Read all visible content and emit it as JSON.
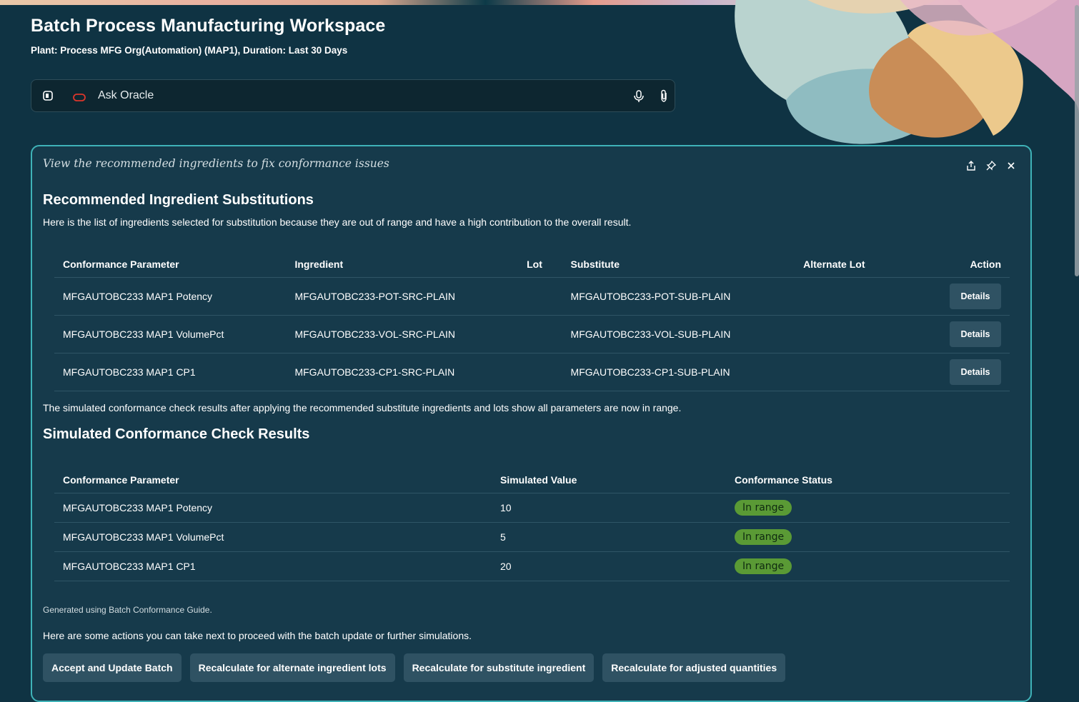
{
  "header": {
    "title": "Batch Process Manufacturing Workspace",
    "subtitle": "Plant: Process MFG Org(Automation) (MAP1), Duration: Last 30 Days"
  },
  "ask": {
    "placeholder": "Ask Oracle"
  },
  "card": {
    "prompt": "View the recommended ingredients to fix conformance issues",
    "substitutions": {
      "heading": "Recommended Ingredient Substitutions",
      "intro": "Here is the list of ingredients selected for substitution because they are out of range and have a high contribution to the overall result.",
      "columns": [
        "Conformance Parameter",
        "Ingredient",
        "Lot",
        "Substitute",
        "Alternate Lot",
        "Action"
      ],
      "rows": [
        {
          "param": "MFGAUTOBC233 MAP1 Potency",
          "ingredient": "MFGAUTOBC233-POT-SRC-PLAIN",
          "lot": "",
          "substitute": "MFGAUTOBC233-POT-SUB-PLAIN",
          "alt_lot": "",
          "action": "Details"
        },
        {
          "param": "MFGAUTOBC233 MAP1 VolumePct",
          "ingredient": "MFGAUTOBC233-VOL-SRC-PLAIN",
          "lot": "",
          "substitute": "MFGAUTOBC233-VOL-SUB-PLAIN",
          "alt_lot": "",
          "action": "Details"
        },
        {
          "param": "MFGAUTOBC233 MAP1 CP1",
          "ingredient": "MFGAUTOBC233-CP1-SRC-PLAIN",
          "lot": "",
          "substitute": "MFGAUTOBC233-CP1-SUB-PLAIN",
          "alt_lot": "",
          "action": "Details"
        }
      ]
    },
    "sim_intro": "The simulated conformance check results after applying the recommended substitute ingredients and lots show all parameters are now in range.",
    "simulated": {
      "heading": "Simulated Conformance Check Results",
      "columns": [
        "Conformance Parameter",
        "Simulated Value",
        "Conformance Status"
      ],
      "rows": [
        {
          "param": "MFGAUTOBC233 MAP1 Potency",
          "value": "10",
          "status": "In range"
        },
        {
          "param": "MFGAUTOBC233 MAP1 VolumePct",
          "value": "5",
          "status": "In range"
        },
        {
          "param": "MFGAUTOBC233 MAP1 CP1",
          "value": "20",
          "status": "In range"
        }
      ]
    },
    "generated_note": "Generated using Batch Conformance Guide.",
    "next_intro": "Here are some actions you can take next to proceed with the batch update or further simulations.",
    "actions": [
      "Accept and Update Batch",
      "Recalculate for alternate ingredient lots",
      "Recalculate for substitute ingredient",
      "Recalculate for adjusted quantities"
    ],
    "status_color": "#5a9a35",
    "accent_border": "#3fb3b8"
  },
  "icons": {
    "sidebar": "sidebar-toggle-icon",
    "oracle": "oracle-logo-icon",
    "mic": "microphone-icon",
    "attach": "paperclip-icon",
    "share": "share-icon",
    "pin": "pin-icon",
    "close": "close-icon"
  }
}
